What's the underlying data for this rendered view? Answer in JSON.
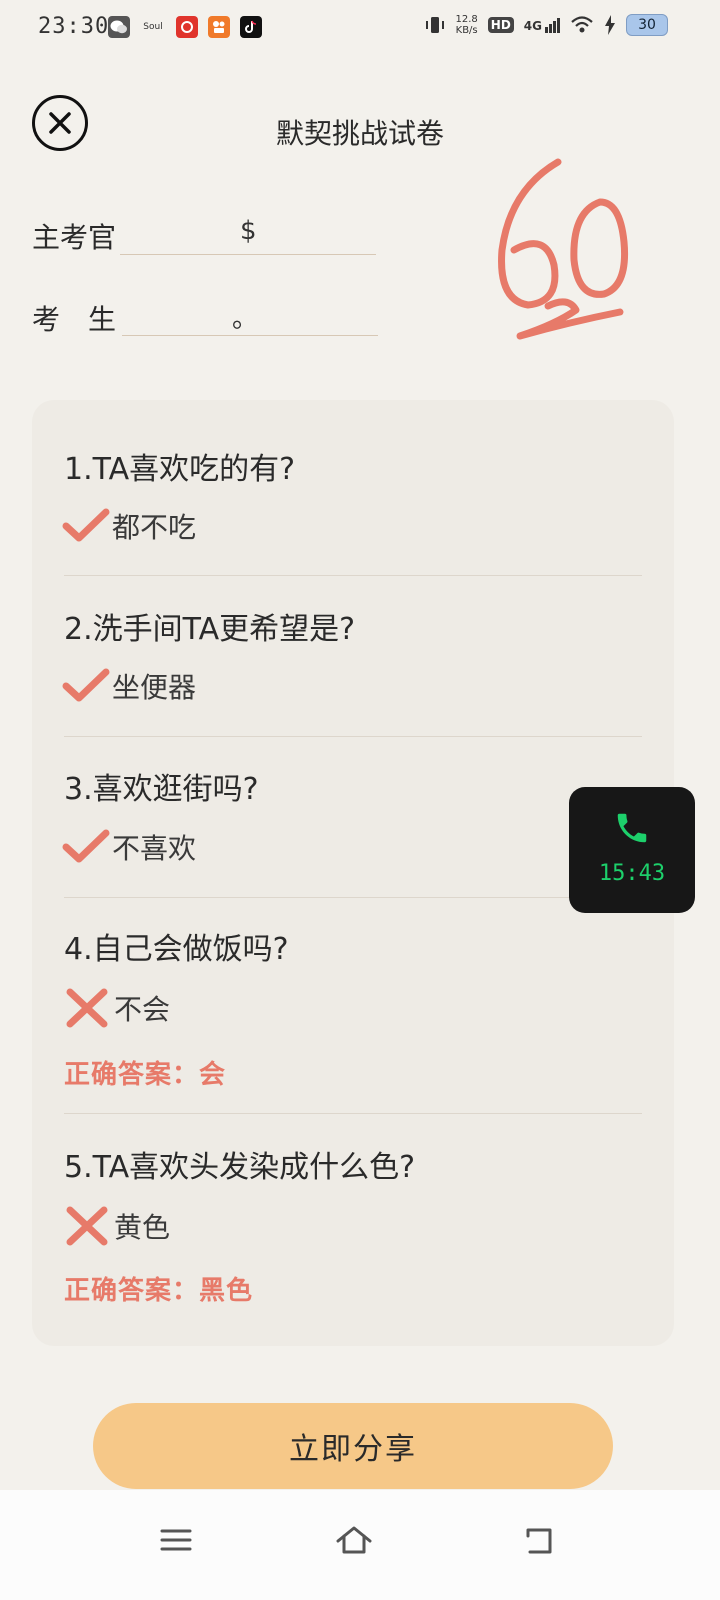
{
  "status_bar": {
    "time": "23:30",
    "app_icons": [
      "wechat-icon",
      "soul-icon",
      "netease-music-icon",
      "kuaishou-icon",
      "douyin-icon"
    ],
    "app_icon_labels": [
      "",
      "Soul",
      "",
      "",
      ""
    ],
    "network_speed": "12.8",
    "network_unit": "KB/s",
    "hd": "HD",
    "network_type": "4G",
    "battery": "30"
  },
  "header": {
    "title": "默契挑战试卷"
  },
  "info": {
    "examiner_label": "主考官",
    "examiner_value": "$",
    "examinee_label": "考　生",
    "examinee_value": "。"
  },
  "score": {
    "value": "60",
    "color": "#e77a69"
  },
  "questions": [
    {
      "title": "1.TA喜欢吃的有?",
      "answer": "都不吃",
      "correct": true
    },
    {
      "title": "2.洗手间TA更希望是?",
      "answer": "坐便器",
      "correct": true
    },
    {
      "title": "3.喜欢逛街吗?",
      "answer": "不喜欢",
      "correct": true
    },
    {
      "title": "4.自己会做饭吗?",
      "answer": "不会",
      "correct": false,
      "correct_answer": "正确答案：会"
    },
    {
      "title": "5.TA喜欢头发染成什么色?",
      "answer": "黄色",
      "correct": false,
      "correct_answer": "正确答案：黑色"
    }
  ],
  "call_widget": {
    "time": "15:43",
    "color": "#1dd06b"
  },
  "share_button": {
    "label": "立即分享",
    "color": "#f6c888"
  },
  "nav_bar": {
    "items": [
      "menu-icon",
      "home-icon",
      "back-icon"
    ]
  }
}
